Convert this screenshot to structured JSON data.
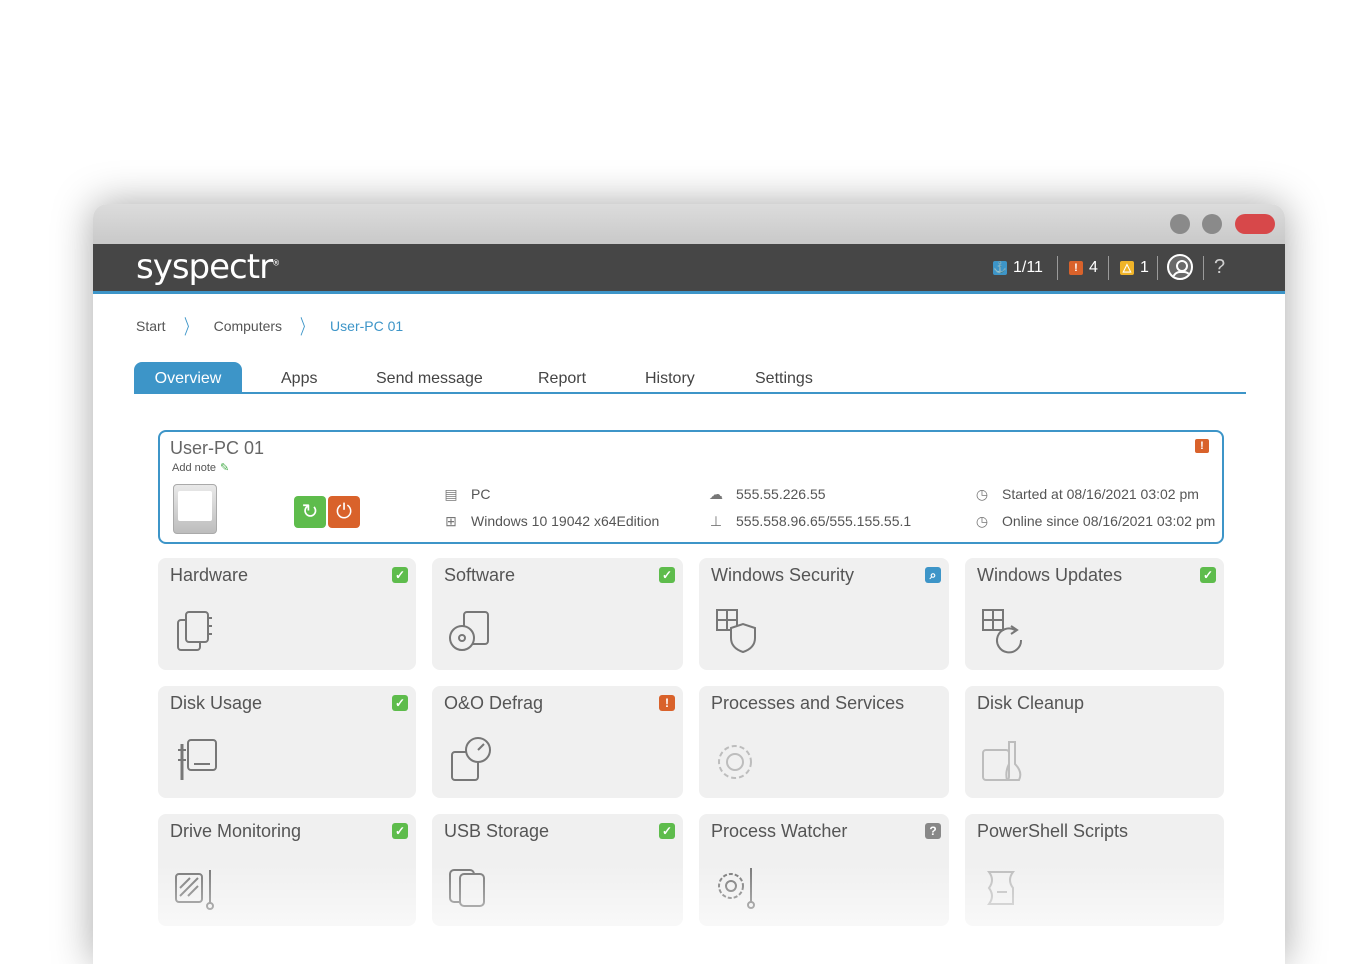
{
  "app": {
    "logo": "syspectr",
    "logo_mark": "®",
    "status": {
      "info_count": "1/11",
      "error_count": "4",
      "warning_count": "1"
    },
    "help_label": "?"
  },
  "breadcrumb": {
    "start": "Start",
    "computers": "Computers",
    "current": "User-PC 01"
  },
  "tabs": [
    {
      "label": "Overview",
      "active": true
    },
    {
      "label": "Apps"
    },
    {
      "label": "Send message"
    },
    {
      "label": "Report"
    },
    {
      "label": "History"
    },
    {
      "label": "Settings"
    }
  ],
  "pc": {
    "name": "User-PC 01",
    "add_note": "Add note",
    "type": "PC",
    "os": "Windows 10 19042 x64Edition",
    "public_ip": "555.55.226.55",
    "local_ip": "555.558.96.65/555.155.55.1",
    "started": "Started at 08/16/2021 03:02 pm",
    "online": "Online since 08/16/2021 03:02 pm"
  },
  "tiles": [
    {
      "title": "Hardware",
      "status": "ok",
      "icon": "hardware-chip-icon"
    },
    {
      "title": "Software",
      "status": "ok",
      "icon": "software-disc-icon"
    },
    {
      "title": "Windows Security",
      "status": "info",
      "icon": "windows-shield-icon"
    },
    {
      "title": "Windows Updates",
      "status": "ok",
      "icon": "windows-refresh-icon"
    },
    {
      "title": "Disk Usage",
      "status": "ok",
      "icon": "disk-usage-icon"
    },
    {
      "title": "O&O Defrag",
      "status": "warn",
      "icon": "defrag-gauge-icon"
    },
    {
      "title": "Processes and Services",
      "status": "none",
      "icon": "gear-process-icon"
    },
    {
      "title": "Disk Cleanup",
      "status": "none",
      "icon": "disk-cleanup-icon"
    },
    {
      "title": "Drive Monitoring",
      "status": "ok",
      "icon": "drive-monitor-icon"
    },
    {
      "title": "USB Storage",
      "status": "ok",
      "icon": "usb-storage-icon"
    },
    {
      "title": "Process Watcher",
      "status": "unknown",
      "icon": "process-watcher-icon"
    },
    {
      "title": "PowerShell Scripts",
      "status": "none",
      "icon": "script-scroll-icon"
    }
  ],
  "colors": {
    "accent": "#3d95c8",
    "ok": "#5ebc4c",
    "warn": "#d9622b",
    "alert": "#f0b429",
    "header": "#464646"
  }
}
